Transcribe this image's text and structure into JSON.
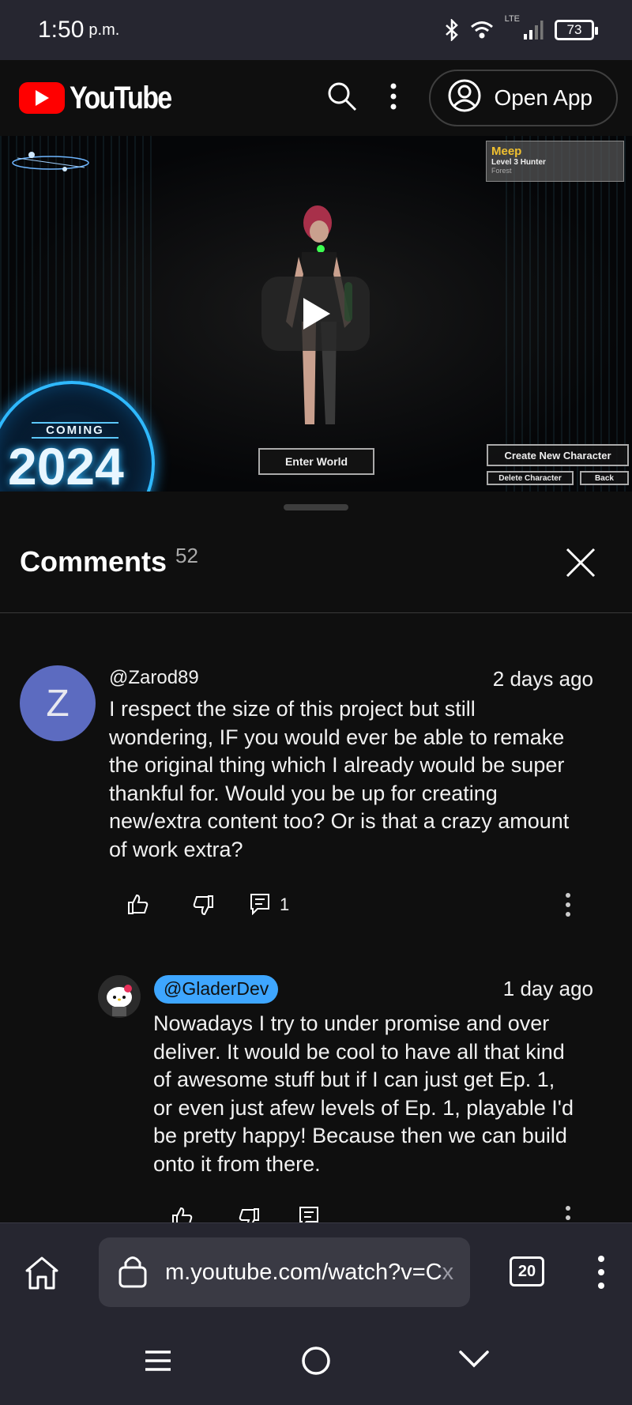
{
  "status_bar": {
    "time": "1:50",
    "ampm": "p.m.",
    "network": "LTE",
    "battery": "73"
  },
  "header": {
    "logo_text": "YouTube",
    "open_app_label": "Open App"
  },
  "video": {
    "game_panel": {
      "name": "Meep",
      "level": "Level 3 Hunter",
      "zone": "Forest"
    },
    "buttons": {
      "enter_world": "Enter World",
      "create_character": "Create New Character",
      "delete_character": "Delete Character",
      "back": "Back"
    },
    "coming_label": "COMING",
    "coming_year": "2024"
  },
  "comments": {
    "title": "Comments",
    "count": "52",
    "items": [
      {
        "avatar_letter": "Z",
        "author": "@Zarod89",
        "time": "2 days ago",
        "text_lines": [
          "I respect the size of this project but still",
          "wondering, IF you would ever be able to remake",
          "the original thing which I already would be super",
          "thankful for. Would you be up for creating",
          "new/extra content too? Or is that a crazy amount",
          "of work extra?"
        ],
        "reply_count": "1"
      },
      {
        "author": "@GladerDev",
        "time": "1 day ago",
        "text_lines": [
          "Nowadays I try to under promise and over",
          "deliver. It would be cool to have all that kind",
          "of awesome stuff but if I can just get Ep. 1,",
          "or even just afew levels of Ep. 1, playable I'd",
          "be pretty happy! Because then we can build",
          "onto it from there."
        ]
      }
    ]
  },
  "browser": {
    "url": "m.youtube.com/watch?v=C",
    "url_fade": "x",
    "tab_count": "20"
  }
}
